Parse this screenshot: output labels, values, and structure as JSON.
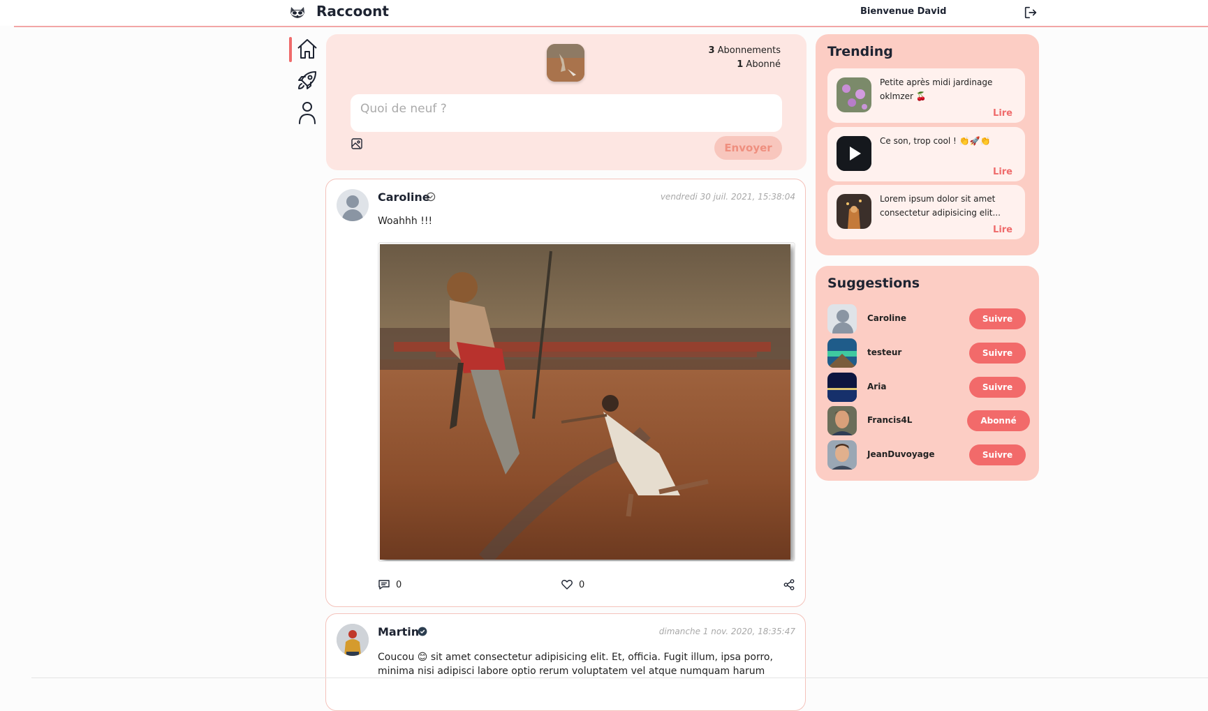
{
  "app": {
    "brand": "Raccoont",
    "logo_icon": "raccoon-icon"
  },
  "header": {
    "welcome": "Bienvenue David",
    "logout_icon": "logout-icon"
  },
  "nav": {
    "items": [
      {
        "name": "home",
        "icon": "home-icon",
        "active": true
      },
      {
        "name": "explore",
        "icon": "rocket-icon",
        "active": false
      },
      {
        "name": "profile",
        "icon": "user-icon",
        "active": false
      }
    ]
  },
  "composer": {
    "following_count": "3",
    "following_label": "Abonnements",
    "followers_count": "1",
    "followers_label": "Abonné",
    "placeholder": "Quoi de neuf ?",
    "send_label": "Envoyer",
    "image_icon": "image-icon"
  },
  "posts": [
    {
      "author": "Caroline",
      "verified": false,
      "date": "vendredi 30 juil. 2021, 15:38:04",
      "text": "Woahhh !!!",
      "comments": "0",
      "likes": "0"
    },
    {
      "author": "Martin",
      "verified": true,
      "date": "dimanche 1 nov. 2020, 18:35:47",
      "text": "Coucou 😊 sit amet consectetur adipisicing elit. Et, officia. Fugit illum, ipsa porro, minima nisi adipisci labore optio rerum voluptatem vel atque numquam harum"
    }
  ],
  "trending": {
    "title": "Trending",
    "items": [
      {
        "text": "Petite après midi jardinage oklmzer 🍒",
        "read": "Lire"
      },
      {
        "text": "Ce son, trop cool ! 👏🚀👏",
        "read": "Lire"
      },
      {
        "text": "Lorem ipsum dolor sit amet consectetur adipisicing elit...",
        "read": "Lire"
      }
    ]
  },
  "suggestions": {
    "title": "Suggestions",
    "items": [
      {
        "name": "Caroline",
        "action": "Suivre"
      },
      {
        "name": "testeur",
        "action": "Suivre"
      },
      {
        "name": "Aria",
        "action": "Suivre"
      },
      {
        "name": "Francis4L",
        "action": "Abonné"
      },
      {
        "name": "JeanDuvoyage",
        "action": "Suivre"
      }
    ]
  },
  "colors": {
    "accent": "#ef6b6b",
    "panel": "#fccdc4",
    "composer": "#fde6e2"
  }
}
